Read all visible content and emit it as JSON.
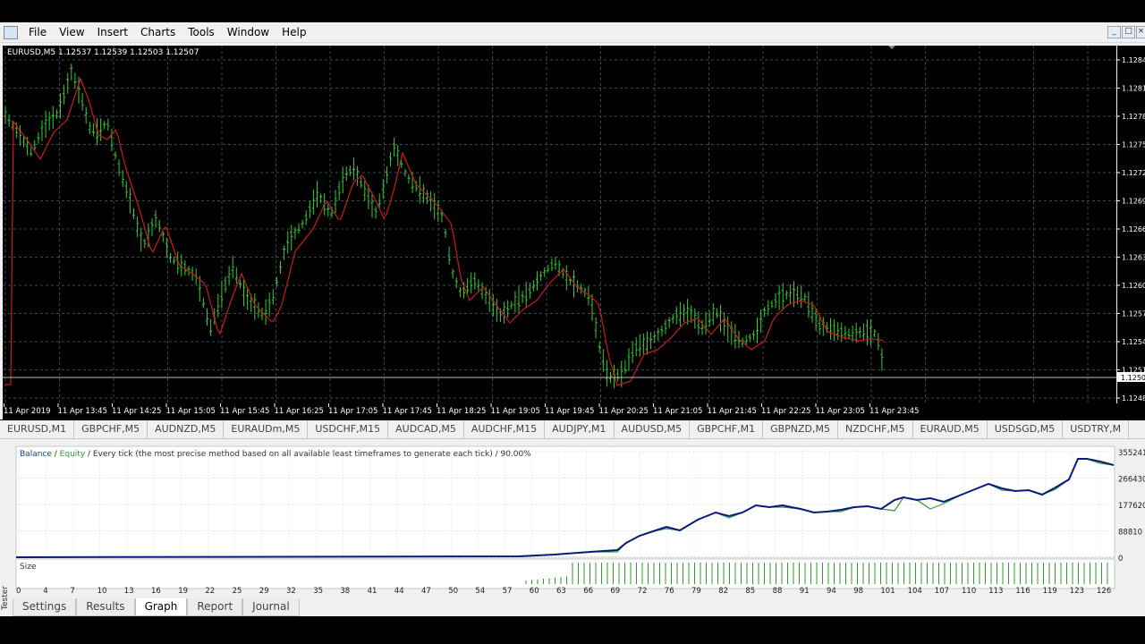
{
  "menu": {
    "items": [
      "File",
      "View",
      "Insert",
      "Charts",
      "Tools",
      "Window",
      "Help"
    ]
  },
  "window_controls": {
    "minimize": "_",
    "restore": "□",
    "close": "×"
  },
  "chart": {
    "header": "EURUSD,M5  1.12537 1.12539 1.12503 1.12507",
    "price_labels": [
      "1.1284",
      "1.1281",
      "1.1278",
      "1.1275",
      "1.1272",
      "1.1269",
      "1.1266",
      "1.1263",
      "1.1260",
      "1.1257",
      "1.1254",
      "1.1251",
      "1.1248"
    ],
    "current_price": "1.1250",
    "time_labels": [
      "11 Apr 2019",
      "11 Apr 13:45",
      "11 Apr 14:25",
      "11 Apr 15:05",
      "11 Apr 15:45",
      "11 Apr 16:25",
      "11 Apr 17:05",
      "11 Apr 17:45",
      "11 Apr 18:25",
      "11 Apr 19:05",
      "11 Apr 19:45",
      "11 Apr 20:25",
      "11 Apr 21:05",
      "11 Apr 21:45",
      "11 Apr 22:25",
      "11 Apr 23:05",
      "11 Apr 23:45"
    ],
    "colors": {
      "background": "#000000",
      "grid": "#3a4a55",
      "bars": "#33cc33",
      "ma": "#cc1a1a",
      "axis_text": "#ffffff"
    }
  },
  "symbol_tabs": [
    "EURUSD,M1",
    "GBPCHF,M5",
    "AUDNZD,M5",
    "EURAUDm,M5",
    "USDCHF,M15",
    "AUDCAD,M5",
    "AUDCHF,M15",
    "AUDJPY,M1",
    "AUDUSD,M5",
    "GBPCHF,M1",
    "GBPNZD,M5",
    "NZDCHF,M5",
    "EURAUD,M5",
    "USDSGD,M5",
    "USDTRY,M"
  ],
  "tester": {
    "side_label": "Tester",
    "legend": {
      "balance": "Balance",
      "sep": " / ",
      "equity": "Equity",
      "mode": " / Every tick (the most precise method based on all available least timeframes to generate each tick) / 90.00%"
    },
    "y_labels": [
      "355241",
      "266430",
      "177620",
      "88810",
      "0"
    ],
    "size_label": "Size",
    "x_labels": [
      "0",
      "4",
      "7",
      "10",
      "13",
      "16",
      "19",
      "22",
      "25",
      "29",
      "32",
      "35",
      "38",
      "41",
      "44",
      "47",
      "50",
      "54",
      "57",
      "60",
      "63",
      "66",
      "69",
      "72",
      "76",
      "79",
      "82",
      "85",
      "88",
      "91",
      "94",
      "98",
      "101",
      "104",
      "107",
      "110",
      "113",
      "116",
      "119",
      "123",
      "126"
    ],
    "colors": {
      "balance": "#0a1a7a",
      "equity": "#2e9e2e",
      "legend_balance": "#1040c0",
      "legend_equity": "#2e9e2e"
    },
    "tabs": [
      "Settings",
      "Results",
      "Graph",
      "Report",
      "Journal"
    ],
    "active_tab": "Graph"
  }
}
